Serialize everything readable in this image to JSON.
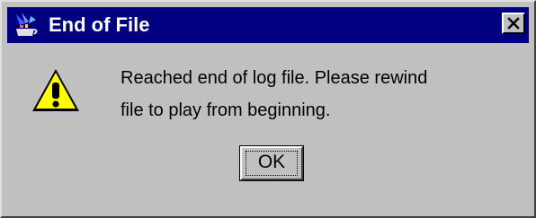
{
  "window": {
    "title": "End of File",
    "app_icon": "java-coffee-cup-icon",
    "close_icon": "close-icon"
  },
  "message": {
    "icon": "warning-icon",
    "line1": "Reached end of log file. Please rewind",
    "line2": "file to play from beginning."
  },
  "buttons": {
    "ok_label": "OK"
  },
  "colors": {
    "titlebar": "#000080",
    "dialog_bg": "#c0c0c0",
    "warning_yellow": "#ffff00"
  }
}
